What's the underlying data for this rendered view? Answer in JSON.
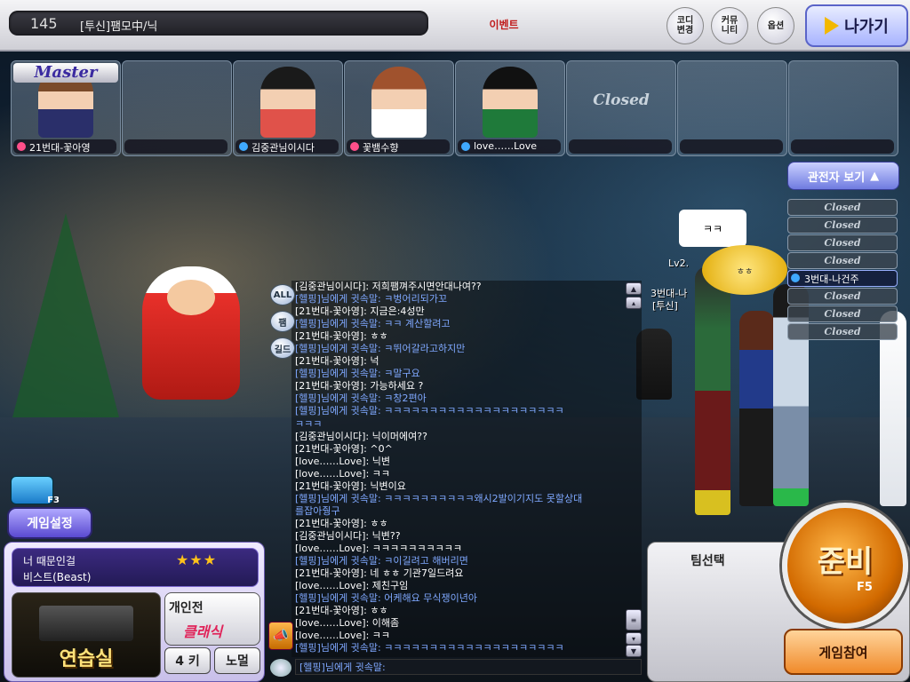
{
  "room": {
    "number": "145",
    "name": "[투신]팸모中/닉"
  },
  "topbar": {
    "event_label": "이벤트",
    "codi_label": "코디\n변경",
    "community_label": "커뮤\n니티",
    "option_label": "옵션",
    "exit_label": "나가기"
  },
  "slots": [
    {
      "name": "21번대-꽃아영",
      "badge": "Master",
      "dot_color": "#ff4f8a",
      "closed": false
    },
    {
      "name": "",
      "closed": false,
      "empty": true
    },
    {
      "name": "김중관님이시다",
      "dot_color": "#3fa9ff",
      "closed": false
    },
    {
      "name": "꽃뱀수향",
      "dot_color": "#ff4f8a",
      "closed": false
    },
    {
      "name": "love……Love",
      "dot_color": "#3fa9ff",
      "closed": false
    },
    {
      "name": "",
      "closed_label": "Closed",
      "closed": true
    },
    {
      "name": "",
      "closed": false,
      "empty": true
    },
    {
      "name": "",
      "closed": false,
      "empty": true
    }
  ],
  "spectator": {
    "button_label": "관전자 보기",
    "rows": [
      "Closed",
      "Closed",
      "Closed",
      "Closed",
      "3번대-나건주",
      "Closed",
      "Closed",
      "Closed"
    ]
  },
  "scene": {
    "bubble_text": "ㅋㅋ",
    "bubble2_text": "ㅎㅎ",
    "label_lv": "Lv2.",
    "label_player": "3번대-나",
    "label_guild": "[투신]"
  },
  "chat_tabs": [
    "ALL",
    "팸",
    "길드"
  ],
  "chat": [
    {
      "text": "[김중관님이시다]: 저희팸껴주시면안대나여??",
      "color": "white"
    },
    {
      "text": "[헬핑]님에게 귓속말: ㅋ벙어리되가꼬",
      "color": "blue"
    },
    {
      "text": "[21번대-꽃아영]: 지금은:4성만",
      "color": "white"
    },
    {
      "text": "[헬핑]님에게 귓속말: ㅋㅋ 계산할려고",
      "color": "blue"
    },
    {
      "text": "[21번대-꽃아영]: ㅎㅎ",
      "color": "white"
    },
    {
      "text": "[헬핑]님에게 귓속말: ㅋ뛰어갈라고하지만",
      "color": "blue"
    },
    {
      "text": "[21번대-꽃아영]: 넉",
      "color": "white"
    },
    {
      "text": "[헬핑]님에게 귓속말: ㅋ말구요",
      "color": "blue"
    },
    {
      "text": "[21번대-꽃아영]: 가능하세요 ?",
      "color": "white"
    },
    {
      "text": "[헬핑]님에게 귓속말: ㅋ창2편아",
      "color": "blue"
    },
    {
      "text": "[헬핑]님에게 귓속말: ㅋㅋㅋㅋㅋㅋㅋㅋㅋㅋㅋㅋㅋㅋㅋㅋㅋㅋㅋㅋ",
      "color": "blue"
    },
    {
      "text": "ㅋㅋㅋ",
      "color": "blue"
    },
    {
      "text": "[김중관님이시다]: 닉이머에여??",
      "color": "white"
    },
    {
      "text": "[21번대-꽃아영]: ^0^",
      "color": "white"
    },
    {
      "text": "[love……Love]: 닉변",
      "color": "white"
    },
    {
      "text": "[love……Love]: ㅋㅋ",
      "color": "white"
    },
    {
      "text": "[21번대-꽃아영]: 닉변이요",
      "color": "white"
    },
    {
      "text": "[헬핑]님에게 귓속말: ㅋㅋㅋㅋㅋㅋㅋㅋㅋㅋ왜시2발이기지도 못할상대",
      "color": "blue"
    },
    {
      "text": "를잡아줭구",
      "color": "blue"
    },
    {
      "text": "[21번대-꽃아영]: ㅎㅎ",
      "color": "white"
    },
    {
      "text": "[김중관님이시다]: 닉변??",
      "color": "white"
    },
    {
      "text": "[love……Love]: ㅋㅋㅋㅋㅋㅋㅋㅋㅋㅋ",
      "color": "white"
    },
    {
      "text": "[헬핑]님에게 귓속말: ㅋ이길려고 해버리면",
      "color": "blue"
    },
    {
      "text": "[21번대-꽃아영]: 네 ㅎㅎ 기관7일드려요",
      "color": "white"
    },
    {
      "text": "[love……Love]: 제친구임",
      "color": "white"
    },
    {
      "text": "[헬핑]님에게 귓속말: 어케해요 무식쟁이년아",
      "color": "blue"
    },
    {
      "text": "[21번대-꽃아영]: ㅎㅎ",
      "color": "white"
    },
    {
      "text": "[love……Love]: 이해좀",
      "color": "white"
    },
    {
      "text": "[love……Love]: ㅋㅋ",
      "color": "white"
    },
    {
      "text": "[헬핑]님에게 귓속말: ㅋㅋㅋㅋㅋㅋㅋㅋㅋㅋㅋㅋㅋㅋㅋㅋㅋㅋㅋㅋ",
      "color": "blue"
    }
  ],
  "chat_input": {
    "value": "[헬핑]님에게 귓속말:"
  },
  "bottom_left": {
    "camera_key": "F3",
    "settings_label": "게임설정",
    "song_title": "너 때문인걸",
    "song_artist": "비스트(Beast)",
    "stars": "★★★",
    "practice_label": "연습실",
    "mode_label_1": "개인전",
    "mode_label_2": "클래식",
    "key_label": "4 키",
    "difficulty_label": "노멀"
  },
  "bottom_right": {
    "team_label": "팀선택",
    "ready_label": "준비",
    "ready_key": "F5",
    "join_label": "게임참여"
  }
}
